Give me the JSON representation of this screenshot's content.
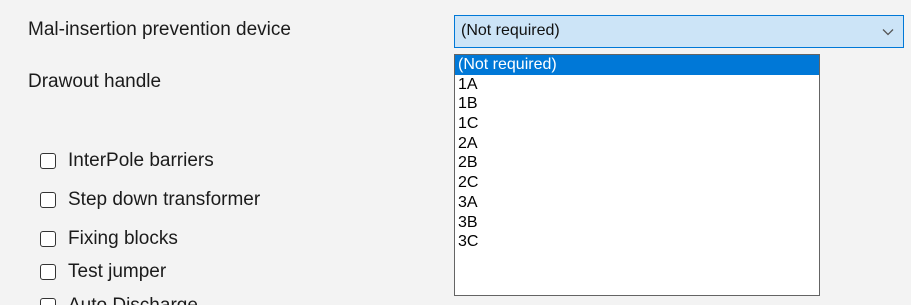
{
  "form": {
    "mal_insertion_label": "Mal-insertion prevention device",
    "drawout_handle_label": "Drawout handle"
  },
  "select": {
    "value": "(Not required)",
    "chevron_icon": "chevron-down-icon"
  },
  "dropdown": {
    "options": [
      {
        "label": "(Not required)",
        "selected": true
      },
      {
        "label": "1A",
        "selected": false
      },
      {
        "label": "1B",
        "selected": false
      },
      {
        "label": "1C",
        "selected": false
      },
      {
        "label": "2A",
        "selected": false
      },
      {
        "label": "2B",
        "selected": false
      },
      {
        "label": "2C",
        "selected": false
      },
      {
        "label": "3A",
        "selected": false
      },
      {
        "label": "3B",
        "selected": false
      },
      {
        "label": "3C",
        "selected": false
      }
    ]
  },
  "checkboxes": [
    {
      "label": "InterPole barriers",
      "checked": false
    },
    {
      "label": "Step down transformer",
      "checked": false
    },
    {
      "label": "Fixing blocks",
      "checked": false
    },
    {
      "label": "Test jumper",
      "checked": false
    },
    {
      "label": "Auto Discharge",
      "checked": false
    }
  ],
  "colors": {
    "accent": "#0078d7",
    "select_background": "#cce4f7",
    "window_background": "#f3f3f3"
  }
}
